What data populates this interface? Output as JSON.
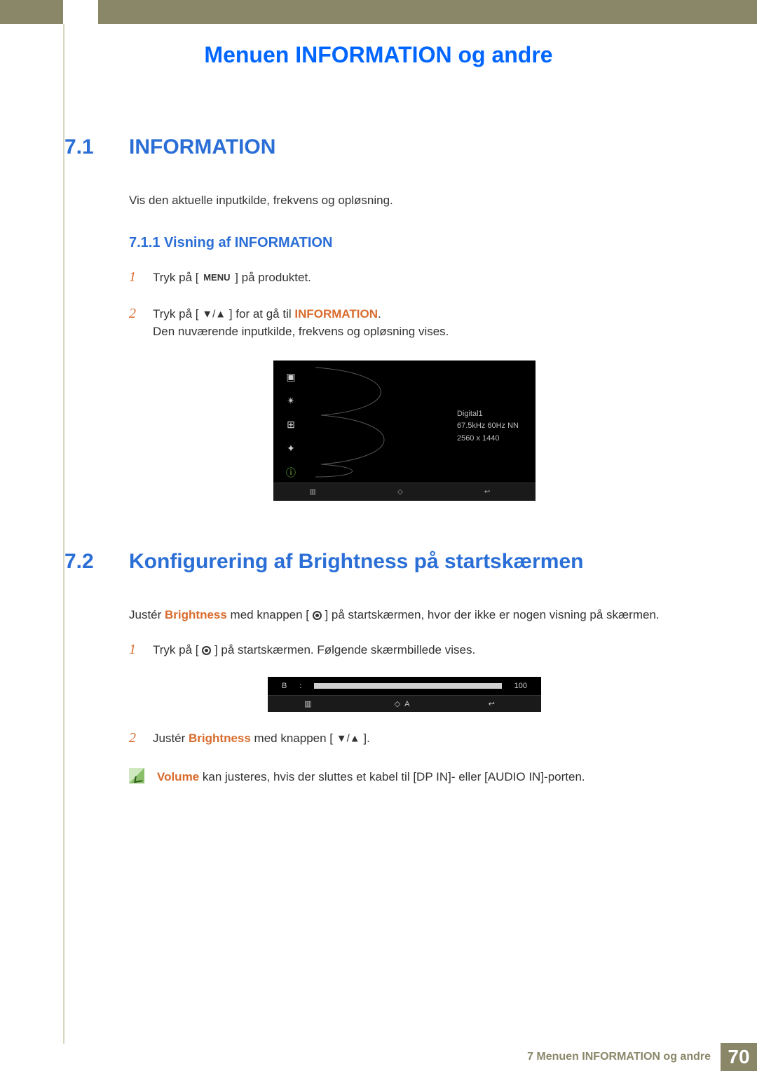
{
  "page_title": "Menuen INFORMATION og andre",
  "section71": {
    "num": "7.1",
    "title": "INFORMATION",
    "intro": "Vis den aktuelle inputkilde, frekvens og opløsning.",
    "sub_num_title": "7.1.1   Visning af INFORMATION",
    "step1_a": "Tryk på [ ",
    "step1_menu": "MENU",
    "step1_b": " ] på produktet.",
    "step2_a": "Tryk på [ ",
    "step2_b": " ] for at gå til ",
    "step2_info": "INFORMATION",
    "step2_c": ".",
    "step2_d": "Den nuværende inputkilde, frekvens og opløsning vises."
  },
  "osd": {
    "info_line1": "Digital1",
    "info_line2": "67.5kHz 60Hz NN",
    "info_line3": "2560 x 1440"
  },
  "section72": {
    "num": "7.2",
    "title": "Konfigurering af Brightness på startskærmen",
    "intro_a": "Justér ",
    "intro_bright": "Brightness",
    "intro_b": " med knappen [ ",
    "intro_c": " ] på startskærmen, hvor der ikke er nogen visning på skærmen.",
    "step1_a": "Tryk på [ ",
    "step1_b": " ] på startskærmen. Følgende skærmbillede vises.",
    "step2_a": "Justér ",
    "step2_bright": "Brightness",
    "step2_b": " med knappen [ ",
    "step2_c": " ].",
    "note_a": "Volume",
    "note_b": "  kan justeres, hvis der sluttes et kabel til [DP IN]- eller [AUDIO IN]-porten."
  },
  "bbar": {
    "label": "B",
    "value": "100"
  },
  "footer": {
    "text": "7 Menuen INFORMATION og andre",
    "page": "70"
  }
}
